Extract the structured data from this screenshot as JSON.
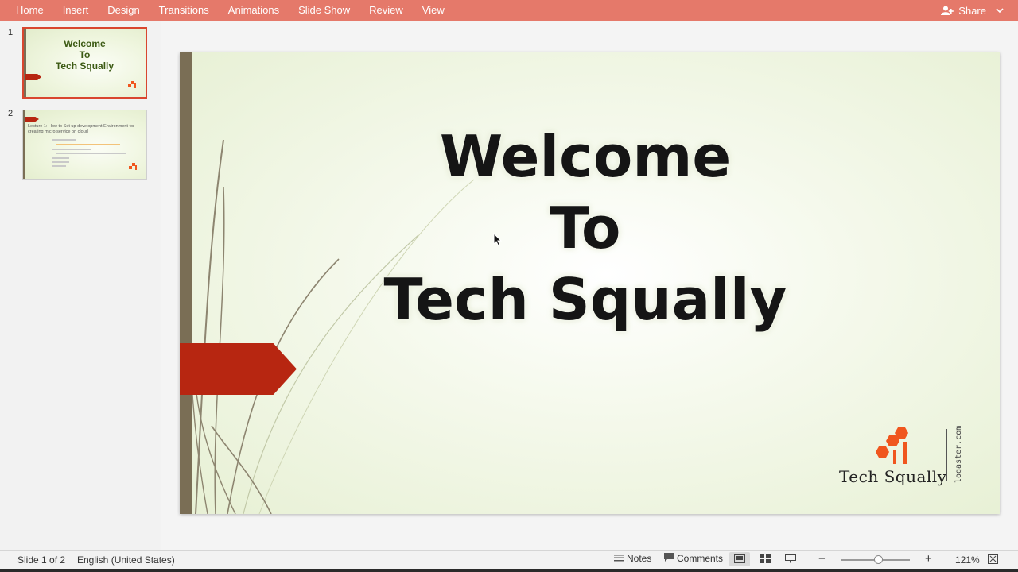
{
  "ribbon": {
    "tabs": [
      "Home",
      "Insert",
      "Design",
      "Transitions",
      "Animations",
      "Slide Show",
      "Review",
      "View"
    ],
    "share_label": "Share"
  },
  "thumbnails": {
    "slide1": {
      "number": "1",
      "title_lines": [
        "Welcome",
        "To",
        "Tech Squally"
      ]
    },
    "slide2": {
      "number": "2",
      "title": "Lecture 1: How to Set up development Environment for creating micro service on cloud"
    }
  },
  "slide": {
    "title_lines": [
      "Welcome",
      "To",
      "Tech Squally"
    ],
    "logo_text": "Tech Squally",
    "logo_side_text": "logaster.com",
    "colors": {
      "accent_bar": "#7a6e55",
      "arrow": "#b72611",
      "logo": "#f0561e"
    }
  },
  "status": {
    "slide_counter": "Slide 1 of 2",
    "language": "English (United States)",
    "notes_label": "Notes",
    "comments_label": "Comments",
    "zoom_label": "121%",
    "zoom_value": 121
  }
}
